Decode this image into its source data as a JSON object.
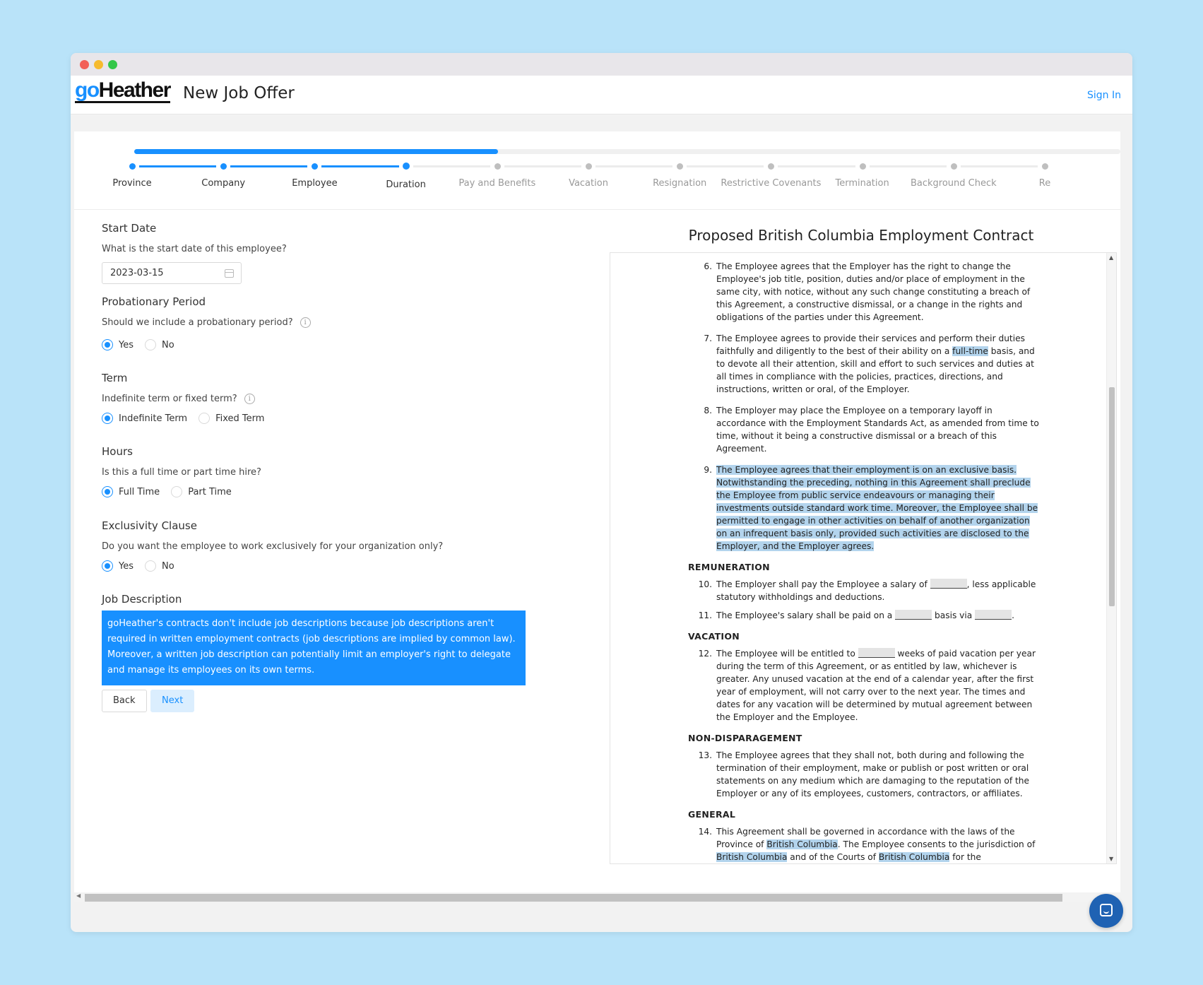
{
  "app": {
    "logo_go": "go",
    "logo_heather": "Heather",
    "page_title": "New Job Offer",
    "sign_in": "Sign In"
  },
  "steps": {
    "items": [
      "Province",
      "Company",
      "Employee",
      "Duration",
      "Pay and Benefits",
      "Vacation",
      "Resignation",
      "Restrictive Covenants",
      "Termination",
      "Background Check",
      "Re"
    ],
    "current_index": 3,
    "progress_percent": 36.9,
    "active_color": "#1890ff",
    "inactive_color": "#bfbfbf"
  },
  "form": {
    "start_date": {
      "title": "Start Date",
      "question": "What is the start date of this employee?",
      "value": "2023-03-15"
    },
    "probation": {
      "title": "Probationary Period",
      "question": "Should we include a probationary period?",
      "options": [
        "Yes",
        "No"
      ],
      "selected": "Yes"
    },
    "term": {
      "title": "Term",
      "question": "Indefinite term or fixed term?",
      "options": [
        "Indefinite Term",
        "Fixed Term"
      ],
      "selected": "Indefinite Term"
    },
    "hours": {
      "title": "Hours",
      "question": "Is this a full time or part time hire?",
      "options": [
        "Full Time",
        "Part Time"
      ],
      "selected": "Full Time"
    },
    "exclusivity": {
      "title": "Exclusivity Clause",
      "question": "Do you want the employee to work exclusively for your organization only?",
      "options": [
        "Yes",
        "No"
      ],
      "selected": "Yes"
    },
    "job_description": {
      "title": "Job Description",
      "text": "goHeather's contracts don't include job descriptions because job descriptions aren't required in written employment contracts (job descriptions are implied by common law). Moreover, a written job description can potentially limit an employer's right to delegate and manage its employees on its own terms."
    },
    "back_label": "Back",
    "next_label": "Next"
  },
  "document": {
    "title": "Proposed British Columbia Employment Contract",
    "c6_num": "6.",
    "c6": "The Employee agrees that the Employer has the right to change the Employee's job title, position, duties and/or place of employment in the same city, with notice, without any such change constituting a breach of this Agreement, a constructive dismissal, or a change in the rights and obligations of the parties under this Agreement.",
    "c7_num": "7.",
    "c7_a": "The Employee agrees to provide their services and perform their duties faithfully and diligently to the best of their ability on a ",
    "c7_hl": "full-time",
    "c7_b": " basis, and to devote all their attention, skill and effort to such services and duties at all times in compliance with the policies, practices, directions, and instructions, written or oral, of the Employer.",
    "c8_num": "8.",
    "c8": "The Employer may place the Employee on a temporary layoff in accordance with the Employment Standards Act, as amended from time to time, without it being a constructive dismissal or a breach of this Agreement.",
    "c9_num": "9.",
    "c9": "The Employee agrees that their employment is on an exclusive basis. Notwithstanding the preceding, nothing in this Agreement shall preclude the Employee from public service endeavours or managing their investments outside standard work time. Moreover, the Employee shall be permitted to engage in other activities on behalf of another organization on an infrequent basis only, provided such activities are disclosed to the Employer, and the Employer agrees.",
    "h_remuneration": "REMUNERATION",
    "c10_num": "10.",
    "c10_a": "The Employer shall pay the Employee a salary of ",
    "c10_b": ", less applicable statutory withholdings and deductions.",
    "c11_num": "11.",
    "c11_a": "The Employee's salary shall be paid on a ",
    "c11_b": " basis via ",
    "c11_c": ".",
    "h_vacation": "VACATION",
    "c12_num": "12.",
    "c12_a": "The Employee will be entitled to ",
    "c12_b": " weeks of paid vacation per year during the term of this Agreement, or as entitled by law, whichever is greater. Any unused vacation at the end of a calendar year, after the first year of employment, will not carry over to the next year. The times and dates for any vacation will be determined by mutual agreement between the Employer and the Employee.",
    "h_nondisparagement": "NON-DISPARAGEMENT",
    "c13_num": "13.",
    "c13": "The Employee agrees that they shall not, both during and following the termination of their employment, make or publish or post written or oral statements on any medium which are damaging to the reputation of the Employer or any of its employees, customers, contractors, or affiliates.",
    "h_general": "GENERAL",
    "c14_num": "14.",
    "c14_a": "This Agreement shall be governed in accordance with the laws of the Province of ",
    "c14_hl1": "British Columbia",
    "c14_b": ". The Employee consents to the jurisdiction of ",
    "c14_hl2": "British Columbia",
    "c14_c": " and of the Courts of ",
    "c14_hl3": "British Columbia",
    "c14_d": " for the"
  }
}
